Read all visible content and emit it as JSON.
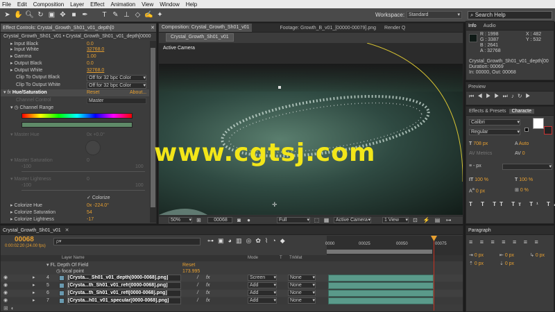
{
  "menu": [
    "File",
    "Edit",
    "Composition",
    "Layer",
    "Effect",
    "Animation",
    "View",
    "Window",
    "Help"
  ],
  "toolbar": {
    "workspace_label": "Workspace:",
    "workspace_value": "Standard",
    "search_placeholder": "Search Help",
    "tools": [
      "arrow-icon",
      "hand-icon",
      "zoom-icon",
      "rotate-icon",
      "camera-icon",
      "pan-behind-icon",
      "rectangle-icon",
      "pen-icon",
      "type-icon",
      "brush-icon",
      "clone-stamp-icon",
      "eraser-icon",
      "roto-brush-icon",
      "puppet-icon"
    ]
  },
  "effect_controls": {
    "tab": "Effect Controls: Crystal_Growth_Sh01_v01_depth[0",
    "subtitle": "Crystal_Growth_Sh01_v01 • Crystal_Growth_Sh01_v01_depth[0000",
    "rows": [
      {
        "label": "Input Black",
        "value": "0.0"
      },
      {
        "label": "Input White",
        "value": "32768.0"
      },
      {
        "label": "Gamma",
        "value": "1.00"
      },
      {
        "label": "Output Black",
        "value": "0.0"
      },
      {
        "label": "Output White",
        "value": "32768.0"
      }
    ],
    "clip_black_label": "Clip To Output Black",
    "clip_black_value": "Off for 32 bpc Color",
    "clip_white_label": "Clip To Output White",
    "clip_white_value": "Off for 32 bpc Color",
    "hue_sat_label": "Hue/Saturation",
    "reset": "Reset",
    "about": "About...",
    "channel_control_label": "Channel Control",
    "channel_control_value": "Master",
    "channel_range_label": "Channel Range",
    "master_hue_label": "Master Hue",
    "master_hue_value": "0x +0.0°",
    "master_sat_label": "Master Saturation",
    "master_sat_value": "0",
    "master_light_label": "Master Lightness",
    "master_light_value": "0",
    "range_min": "-100",
    "range_max": "100",
    "colorize_label": "Colorize",
    "colorize_hue_label": "Colorize Hue",
    "colorize_hue_value": "0x -224.0°",
    "colorize_sat_label": "Colorize Saturation",
    "colorize_sat_value": "54",
    "colorize_light_label": "Colorize Lightness",
    "colorize_light_value": "-17"
  },
  "composition": {
    "tab": "Composition: Crystal_Growth_Sh01_v01",
    "footage_tab": "Footage: Growth_B_v01_[00000-00079].png",
    "render_tab": "Render Q",
    "subtab": "Crystal_Growth_Sh01_v01",
    "active_camera": "Active Camera",
    "zoom": "50%",
    "timecode": "00068",
    "resolution": "Full",
    "camera_select": "Active Camera",
    "view_select": "1 View"
  },
  "info": {
    "tab_info": "Info",
    "tab_audio": "Audio",
    "r": "R : 1998",
    "g": "G : 3387",
    "b": "B : 2641",
    "a": "A : 32768",
    "x": "X : 482",
    "y": "Y : 532",
    "layer": "Crystal_Growth_Sh01_v01_depth[00",
    "duration": "Duration: 00069",
    "in_out": "In: 00000, Out: 00068"
  },
  "preview": {
    "tab": "Preview"
  },
  "character": {
    "tab_effects": "Effects & Presets",
    "tab_char": "Characte",
    "font": "Calibri",
    "style": "Regular",
    "size": "708 px",
    "leading": "Auto",
    "metrics": "Metrics",
    "tracking": "0",
    "stroke": "- px",
    "vscale": "100 %",
    "hscale": "100 %",
    "baseline": "0 px",
    "tsume": "0 %"
  },
  "paragraph": {
    "tab": "Paragraph",
    "indent_left": "0 px",
    "indent_right": "0 px",
    "indent_first": "0 px",
    "space_before": "0 px",
    "space_after": "0 px"
  },
  "timeline": {
    "tab": "Crystal_Growth_Sh01_v01",
    "timecode": "00068",
    "timecode_sub": "0:00:02:20 (24.00 fps)",
    "search_placeholder": "ρ▾",
    "col_layer": "Layer Name",
    "col_mode": "Mode",
    "col_t": "T",
    "col_trkmat": "TrkMat",
    "effect_row": "FL Depth Of Field",
    "effect_reset": "Reset",
    "focal_label": "focal point",
    "focal_value": "173.995",
    "ruler": [
      "0000",
      "00025",
      "00050",
      "00075"
    ],
    "layers": [
      {
        "num": "4",
        "name": "[Crysta..._Sh01_v01_depth[0000-0068].png]",
        "mode": "Screen",
        "trk": "None"
      },
      {
        "num": "5",
        "name": "[Crysta...th_Sh01_v01_refr[0000-0068].png]",
        "mode": "Add",
        "trk": "None"
      },
      {
        "num": "6",
        "name": "[Crysta...th_Sh01_v01_refl[0000-0068].png]",
        "mode": "Add",
        "trk": "None"
      },
      {
        "num": "7",
        "name": "[Crysta...h01_v01_specular[0000-0068].png]",
        "mode": "Add",
        "trk": "None"
      }
    ]
  },
  "watermark": "www.cgtsj.com",
  "colors": {
    "accent": "#e8a030",
    "track": "#5a9a8a",
    "watermark": "#f2e619",
    "playhead": "#e8a030"
  }
}
